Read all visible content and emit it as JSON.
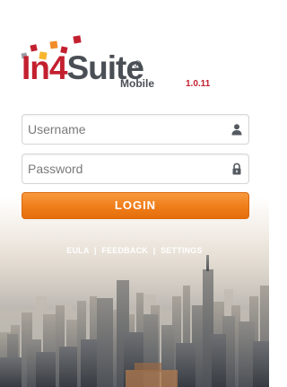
{
  "brand": {
    "name_part1": "In4",
    "name_part2": "Suite",
    "registered_mark": "®",
    "edition": "Mobile",
    "version": "1.0.11",
    "colors": {
      "red": "#c3202f",
      "gray": "#4a4f55",
      "orange": "#f28c28",
      "yellow": "#f6b52d"
    }
  },
  "login_form": {
    "username_placeholder": "Username",
    "username_value": "",
    "username_icon": "user-icon",
    "password_placeholder": "Password",
    "password_value": "",
    "password_icon": "lock-icon",
    "submit_label": "LOGIN",
    "submit_color": "#ef7d1a"
  },
  "footer_links": {
    "eula": "EULA",
    "feedback": "FEEDBACK",
    "settings": "SETTINGS",
    "separator": "|"
  }
}
